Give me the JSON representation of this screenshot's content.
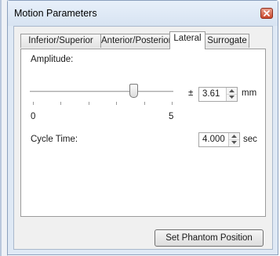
{
  "window": {
    "title": "Motion Parameters"
  },
  "tabs": [
    {
      "label": "Inferior/Superior"
    },
    {
      "label": "Anterior/Posterior"
    },
    {
      "label": "Lateral"
    },
    {
      "label": "Surrogate"
    }
  ],
  "active_tab": "Lateral",
  "amplitude": {
    "label": "Amplitude:",
    "slider_min_label": "0",
    "slider_max_label": "5",
    "slider_value": 3.61,
    "plus_minus": "±",
    "value": "3.61",
    "unit": "mm"
  },
  "cycle_time": {
    "label": "Cycle Time:",
    "value": "4.000",
    "unit": "sec"
  },
  "buttons": {
    "set_phantom_position": "Set Phantom Position"
  },
  "colors": {
    "window_frame": "#dfe9f5",
    "close_button": "#c9472c",
    "panel_bg": "#f0f0f0"
  }
}
